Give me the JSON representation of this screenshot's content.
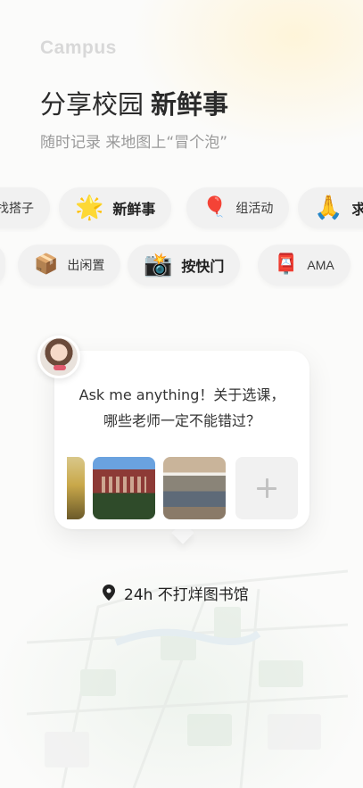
{
  "brand": "Campus",
  "headline": {
    "regular": "分享校园",
    "strong": "新鲜事"
  },
  "subline": "随时记录 来地图上“冒个泡”",
  "chips_row1": [
    {
      "label": "找搭子",
      "icon": "partial",
      "big": false
    },
    {
      "label": "新鲜事",
      "icon": "star-icon",
      "emoji": "🌟",
      "big": true
    },
    {
      "label": "组活动",
      "icon": "balloon-icon",
      "emoji": "🎈",
      "big": false
    },
    {
      "label": "求",
      "icon": "pray-icon",
      "emoji": "🙏",
      "big": true
    }
  ],
  "chips_row2": [
    {
      "label": "出闲置",
      "icon": "package-icon",
      "emoji": "📦",
      "big": false
    },
    {
      "label": "按快门",
      "icon": "camera-flash-icon",
      "emoji": "📸",
      "big": true
    },
    {
      "label": "AMA",
      "icon": "mailbox-icon",
      "emoji": "📮",
      "big": false
    }
  ],
  "card": {
    "question_line1": "Ask me anything！关于选课，",
    "question_line2": "哪些老师一定不能错过？",
    "photos": [
      "campus-photo",
      "campus-building-photo",
      "library-interior-photo"
    ],
    "add_icon": "plus-icon"
  },
  "location": {
    "icon": "map-pin-icon",
    "label": "24h 不打烊图书馆"
  },
  "colors": {
    "accent_red": "#e15a6e",
    "chip_bg": "#f1f1f1",
    "text_dark": "#222222",
    "text_muted": "#9a9a9a"
  }
}
